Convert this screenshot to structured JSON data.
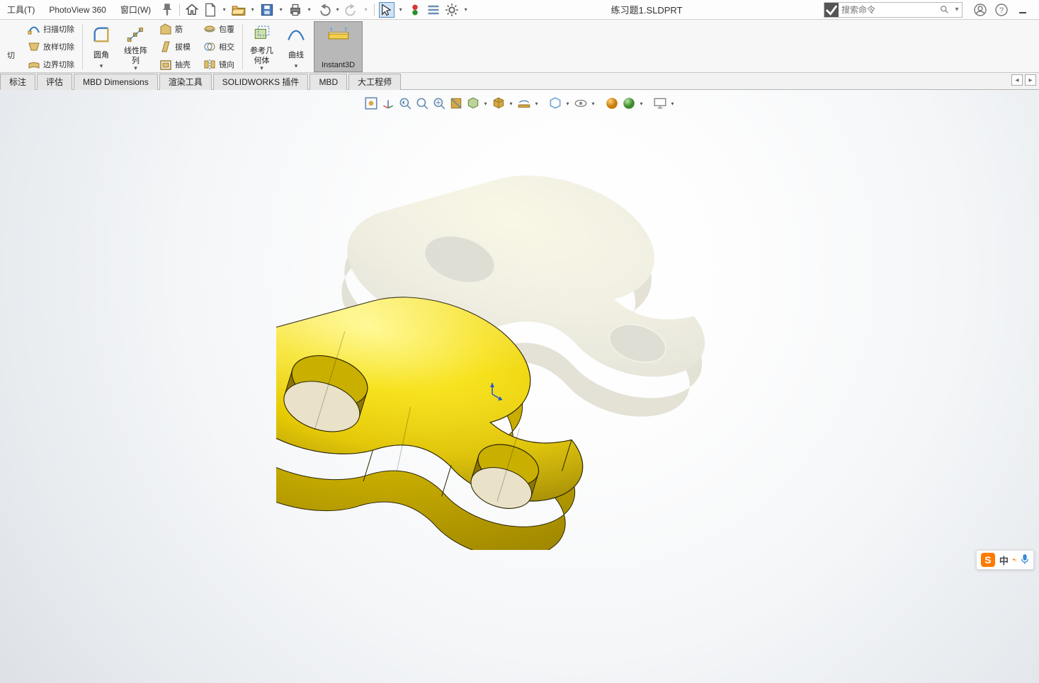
{
  "menubar": {
    "item_tools": "工具(T)",
    "item_photoview": "PhotoView 360",
    "item_window": "窗口(W)"
  },
  "doc_title": "练习题1.SLDPRT",
  "search": {
    "placeholder": "搜索命令"
  },
  "ribbon": {
    "cut_text": "切",
    "sweep_cut": "扫描切除",
    "loft_cut": "放样切除",
    "boundary_cut": "边界切除",
    "fillet": "圆角",
    "linear_pattern": "线性阵\n列",
    "rib": "筋",
    "draft": "拔模",
    "shell": "抽壳",
    "wrap": "包覆",
    "intersect": "相交",
    "mirror": "镜向",
    "ref_geom": "参考几\n何体",
    "curves": "曲线",
    "instant3d": "Instant3D"
  },
  "tabs": {
    "t1": "标注",
    "t2": "评估",
    "t3": "MBD Dimensions",
    "t4": "渲染工具",
    "t5": "SOLIDWORKS 插件",
    "t6": "MBD",
    "t7": "大工程师"
  },
  "hud_icons": [
    "zoom-fit-icon",
    "triad-icon",
    "prev-view-icon",
    "zoom-area-icon",
    "zoom-icon",
    "section-view-icon",
    "view-orientation-icon",
    "display-style-icon",
    "hide-show-icon",
    "edit-appearance-icon",
    "appearances-icon",
    "apply-scene-icon",
    "view-settings-icon",
    "render-gold-icon",
    "render-green-icon",
    "screen-icon"
  ],
  "ime": {
    "lang": "中"
  }
}
